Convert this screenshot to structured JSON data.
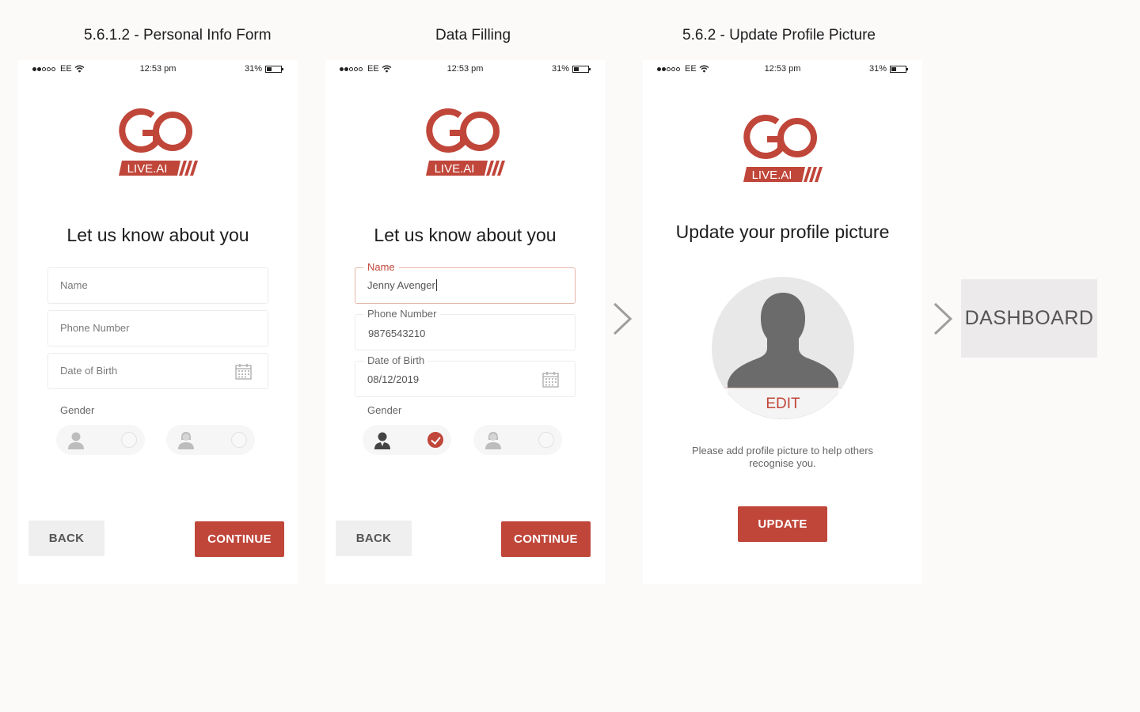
{
  "labels": {
    "screen1": "5.6.1.2 - Personal Info Form",
    "screen2": "Data Filling",
    "screen3": "5.6.2 - Update Profile Picture"
  },
  "statusbar": {
    "carrier": "EE",
    "time": "12:53 pm",
    "battery": "31%"
  },
  "logo": {
    "text": "LIVE.AI",
    "brand_color": "#c0463a"
  },
  "form": {
    "heading": "Let us know about you",
    "name_placeholder": "Name",
    "phone_placeholder": "Phone Number",
    "dob_placeholder": "Date of Birth",
    "gender_label": "Gender",
    "back_label": "BACK",
    "continue_label": "CONTINUE"
  },
  "filled": {
    "name_label": "Name",
    "name_value": "Jenny Avenger",
    "phone_label": "Phone Number",
    "phone_value": "9876543210",
    "dob_label": "Date of Birth",
    "dob_value": "08/12/2019",
    "selected_gender": "male"
  },
  "profile": {
    "heading": "Update your profile picture",
    "edit_label": "EDIT",
    "help_text": "Please add profile picture to help others recognise you.",
    "update_label": "UPDATE"
  },
  "dashboard": {
    "label": "DASHBOARD"
  },
  "colors": {
    "accent": "#c0463a",
    "background": "#fbfaf9",
    "button_grey": "#efefef"
  }
}
